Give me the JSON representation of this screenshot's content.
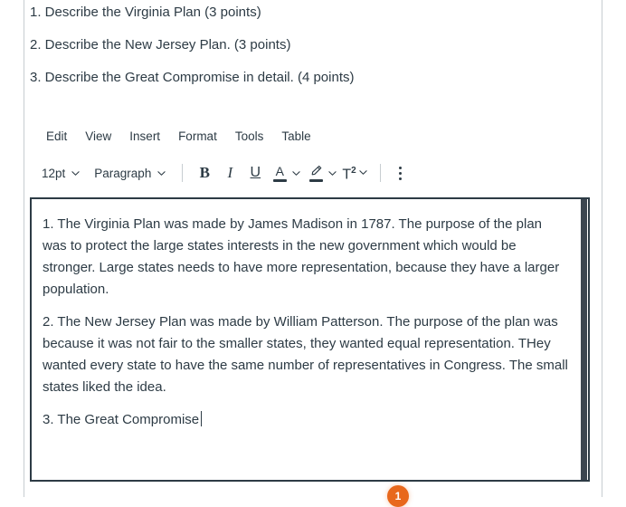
{
  "prompts": [
    {
      "text": "1. Describe the Virginia Plan (3 points)"
    },
    {
      "text": "2. Describe the New Jersey Plan. (3 points)"
    },
    {
      "text": "3. Describe the Great Compromise in detail. (4 points)"
    }
  ],
  "menubar": {
    "items": [
      {
        "label": "Edit",
        "name": "menu-edit"
      },
      {
        "label": "View",
        "name": "menu-view"
      },
      {
        "label": "Insert",
        "name": "menu-insert"
      },
      {
        "label": "Format",
        "name": "menu-format"
      },
      {
        "label": "Tools",
        "name": "menu-tools"
      },
      {
        "label": "Table",
        "name": "menu-table"
      }
    ]
  },
  "toolbar": {
    "font_size_value": "12pt",
    "block_format_value": "Paragraph",
    "bold_label": "B",
    "italic_label": "I",
    "underline_label": "U",
    "text_color_glyph": "A",
    "highlight_glyph": "✐",
    "superscript_base": "T",
    "superscript_exp": "2",
    "more_label": "",
    "icons": {
      "chevron": "chevron-down-icon",
      "text_color": "text-color-icon",
      "highlight": "highlight-color-icon",
      "superscript": "superscript-icon",
      "kebab": "more-options-icon"
    }
  },
  "editor": {
    "paragraphs": [
      "1. The Virginia Plan was made by James Madison in 1787. The purpose of the plan was to protect the large states interests in the new government which would be stronger. Large states needs to have more representation, because they have a larger population.",
      "2. The New Jersey Plan was made by William Patterson. The purpose of the plan was because it was not fair to the smaller states, they wanted equal representation. THey wanted every state to have the same number of representatives in Congress. The small states liked the idea.",
      "3. The Great Compromise"
    ]
  },
  "badge": {
    "label": "1",
    "color": "#e8681c"
  },
  "colors": {
    "text": "#2d3b45",
    "rule": "#c7cdd1",
    "editor_border": "#2d3b45",
    "scrollbar_thumb": "#3c4650",
    "background": "#ffffff"
  }
}
